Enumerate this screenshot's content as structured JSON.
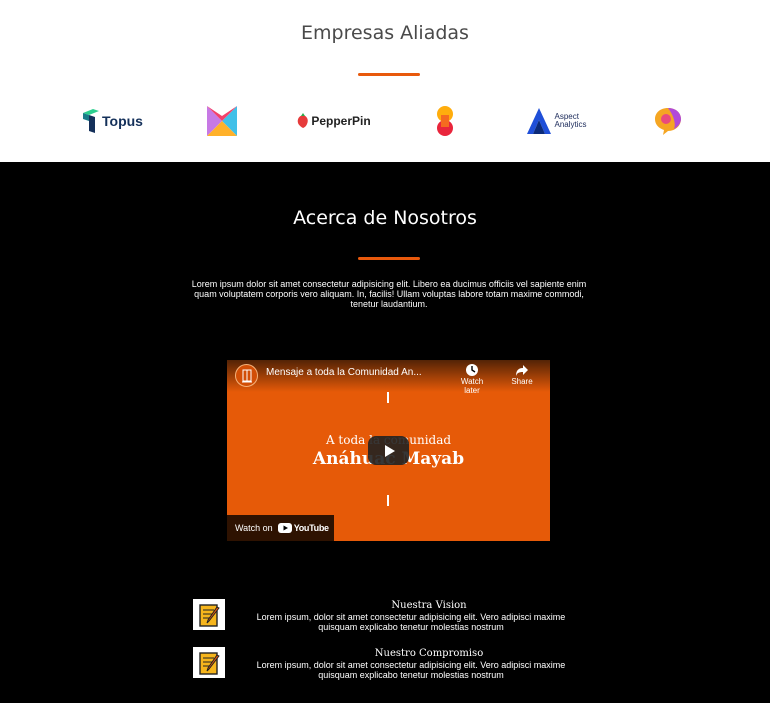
{
  "partners": {
    "title": "Empresas Aliadas",
    "logos": [
      {
        "name": "Topus",
        "icon": "topus-logo"
      },
      {
        "name": "",
        "icon": "m-logo"
      },
      {
        "name": "PepperPin",
        "icon": "pepperpin-logo"
      },
      {
        "name": "",
        "icon": "s-logo"
      },
      {
        "name": "Aspect",
        "sub": "Analytics",
        "icon": "aspect-analytics-logo"
      },
      {
        "name": "",
        "icon": "chat-bubble-logo"
      }
    ]
  },
  "about": {
    "title": "Acerca de Nosotros",
    "text": "Lorem ipsum dolor sit amet consectetur adipisicing elit. Libero ea ducimus officiis vel sapiente enim quam voluptatem corporis vero aliquam. In, facilis! Ullam voluptas labore totam maxime commodi, tenetur laudantium.",
    "video": {
      "title": "Mensaje a toda la Comunidad An...",
      "watch_later": "Watch later",
      "share": "Share",
      "line1": "A toda la comunidad",
      "line2": "Anáhuac Mayab",
      "watch_on": "Watch on",
      "youtube": "YouTube"
    },
    "items": [
      {
        "title": "Nuestra Vision",
        "text": "Lorem ipsum, dolor sit amet consectetur adipisicing elit. Vero adipisci maxime quisquam explicabo tenetur molestias nostrum"
      },
      {
        "title": "Nuestro Compromiso",
        "text": "Lorem ipsum, dolor sit amet consectetur adipisicing elit. Vero adipisci maxime quisquam explicabo tenetur molestias nostrum"
      }
    ]
  },
  "colors": {
    "accent": "#e8590c",
    "video_bg": "#e65a08",
    "dark": "#000000",
    "light": "#ffffff"
  }
}
